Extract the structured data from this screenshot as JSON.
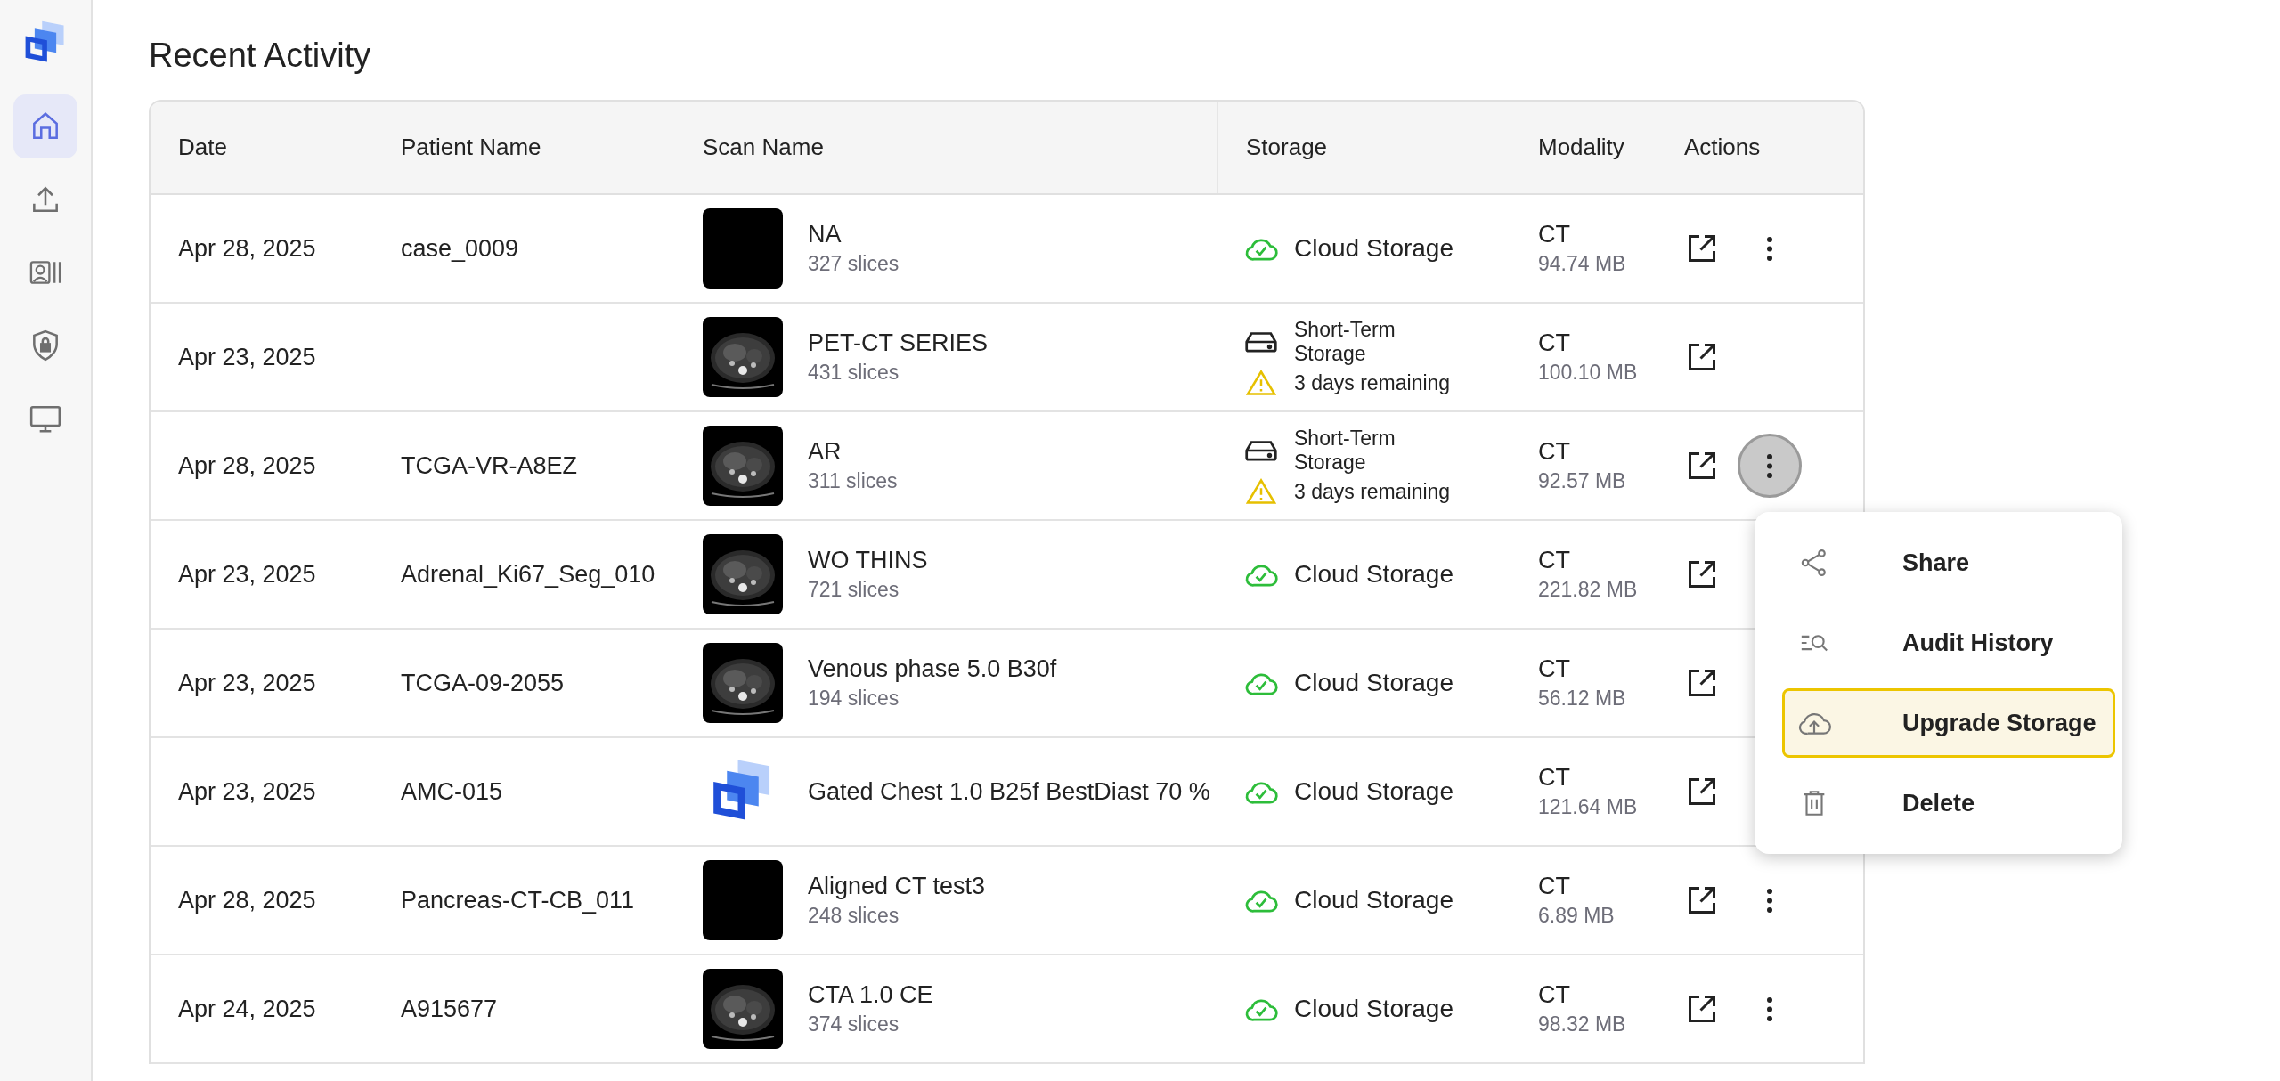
{
  "sidebar": {
    "items": [
      {
        "kind": "home",
        "selected": true
      },
      {
        "kind": "upload",
        "selected": false
      },
      {
        "kind": "contacts",
        "selected": false
      },
      {
        "kind": "shield",
        "selected": false
      },
      {
        "kind": "monitor",
        "selected": false
      }
    ]
  },
  "title": "Recent Activity",
  "table": {
    "columns": [
      "Date",
      "Patient Name",
      "Scan Name",
      "Storage",
      "Modality",
      "Actions"
    ],
    "rows": [
      {
        "date": "Apr 28, 2025",
        "patient": "case_0009",
        "thumbnail": {
          "kind": "blank"
        },
        "scan": "NA",
        "slices": "327 slices",
        "storage": {
          "kind": "cloud",
          "label": "Cloud Storage"
        },
        "modality": "CT",
        "size": "94.74 MB",
        "more_button": true,
        "menu_open": false
      },
      {
        "date": "Apr 23, 2025",
        "scan": "PET-CT SERIES",
        "slices": "431 slices",
        "storage": {
          "kind": "short_term",
          "label": "Short-Term Storage",
          "warning": "3 days remaining"
        },
        "modality": "CT",
        "size": "100.10 MB",
        "more_button": false,
        "menu_open": false
      },
      {
        "date": "Apr 28, 2025",
        "patient": "TCGA-VR-A8EZ",
        "scan": "AR",
        "slices": "311 slices",
        "storage": {
          "kind": "short_term",
          "label": "Short-Term Storage",
          "warning": "3 days remaining"
        },
        "modality": "CT",
        "size": "92.57 MB",
        "more_button": true,
        "menu_open": true
      },
      {
        "date": "Apr 23, 2025",
        "patient": "Adrenal_Ki67_Seg_010",
        "scan": "WO THINS",
        "slices": "721 slices",
        "storage": {
          "kind": "cloud",
          "label": "Cloud Storage"
        },
        "modality": "CT",
        "size": "221.82 MB",
        "more_button": false,
        "menu_open": false
      },
      {
        "date": "Apr 23, 2025",
        "patient": "TCGA-09-2055",
        "scan": "Venous phase 5.0 B30f",
        "slices": "194 slices",
        "storage": {
          "kind": "cloud",
          "label": "Cloud Storage"
        },
        "modality": "CT",
        "size": "56.12 MB",
        "more_button": false,
        "menu_open": false
      },
      {
        "date": "Apr 23, 2025",
        "patient": "AMC-015",
        "thumbnail": {
          "kind": "logo"
        },
        "scan": "Gated Chest 1.0 B25f BestDiast 70 %",
        "modality": "CT",
        "size": "121.64 MB",
        "storage": {
          "kind": "cloud",
          "label": "Cloud Storage"
        },
        "more_button": false,
        "menu_open": false
      },
      {
        "date": "Apr 28, 2025",
        "patient": "Pancreas-CT-CB_011",
        "thumbnail": {
          "kind": "blank"
        },
        "scan": "Aligned CT test3",
        "slices": "248 slices",
        "storage": {
          "kind": "cloud",
          "label": "Cloud Storage"
        },
        "modality": "CT",
        "size": "6.89 MB",
        "more_button": true,
        "menu_open": false
      },
      {
        "date": "Apr 24, 2025",
        "patient": "A915677",
        "scan": "CTA 1.0 CE",
        "slices": "374 slices",
        "storage": {
          "kind": "cloud",
          "label": "Cloud Storage"
        },
        "modality": "CT",
        "size": "98.32 MB",
        "more_button": true,
        "menu_open": false
      }
    ]
  },
  "menu": {
    "items": [
      {
        "kind": "share",
        "label": "Share",
        "selected": false
      },
      {
        "kind": "audit",
        "label": "Audit History",
        "selected": false
      },
      {
        "kind": "upgrade",
        "label": "Upgrade Storage",
        "selected": true
      },
      {
        "kind": "delete",
        "label": "Delete",
        "selected": false
      }
    ]
  }
}
